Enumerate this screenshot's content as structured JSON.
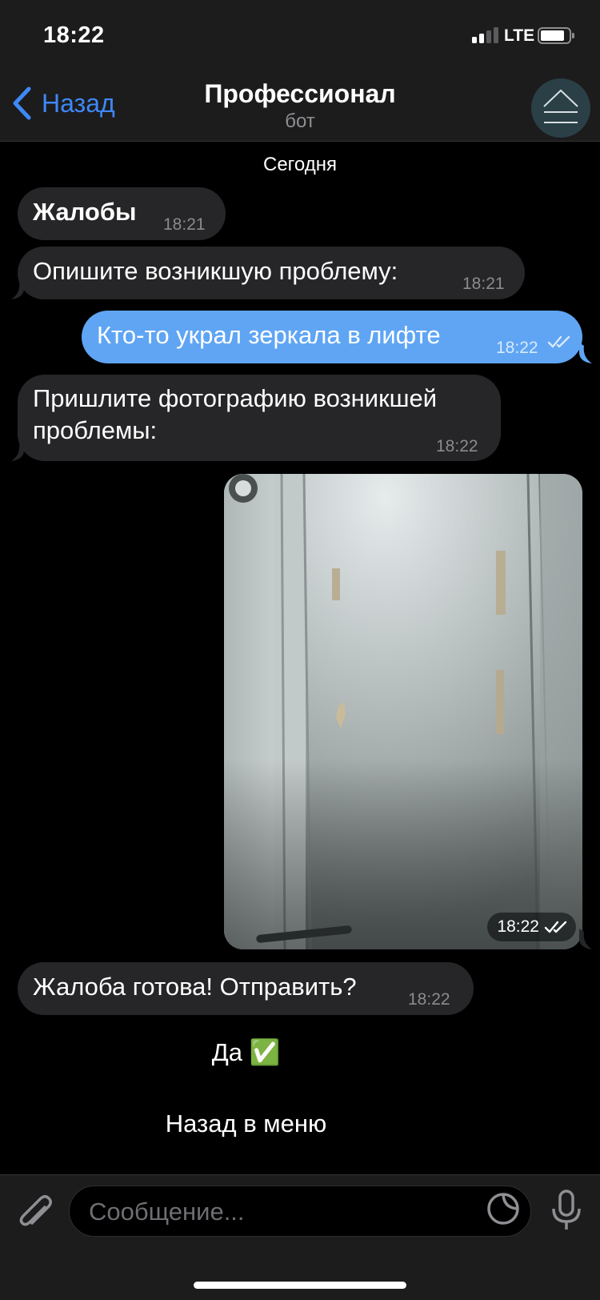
{
  "status_bar": {
    "time": "18:22",
    "network": "LTE"
  },
  "header": {
    "back_label": "Назад",
    "title": "Профессионал",
    "subtitle": "бот"
  },
  "chat": {
    "date_separator": "Сегодня",
    "messages": [
      {
        "direction": "incoming",
        "text": "Жалобы",
        "time": "18:21"
      },
      {
        "direction": "incoming",
        "text": "Опишите возникшую проблему:",
        "time": "18:21"
      },
      {
        "direction": "outgoing",
        "text": "Кто-то украл зеркала в лифте",
        "time": "18:22",
        "status": "read"
      },
      {
        "direction": "incoming",
        "text_line1": "Пришлите фотографию возникшей",
        "text_line2": "проблемы:",
        "time": "18:22"
      },
      {
        "direction": "outgoing",
        "type": "photo",
        "time": "18:22",
        "status": "read"
      },
      {
        "direction": "incoming",
        "text": "Жалоба готова! Отправить?",
        "time": "18:22"
      }
    ]
  },
  "keyboard": {
    "buttons": [
      {
        "label": "Да ✅"
      },
      {
        "label": "Назад в меню"
      }
    ]
  },
  "input": {
    "placeholder": "Сообщение...",
    "icons": [
      "paperclip-icon",
      "sticker-icon",
      "microphone-icon"
    ]
  },
  "colors": {
    "accent": "#3e88f7",
    "outgoing_bubble": "#5fa5f4",
    "incoming_bubble": "#262628",
    "background": "#000000",
    "bars": "#1c1c1d"
  }
}
